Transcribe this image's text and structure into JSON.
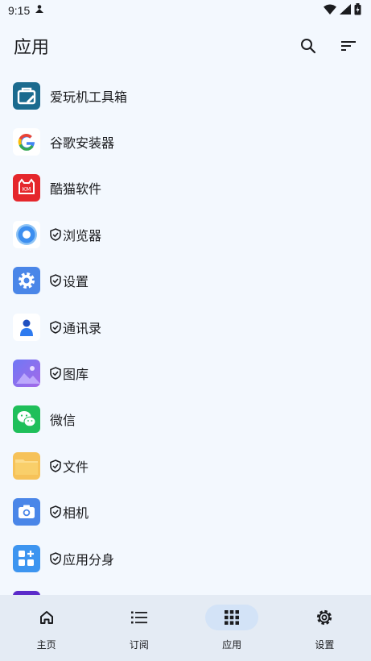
{
  "status": {
    "time": "9:15"
  },
  "header": {
    "title": "应用"
  },
  "apps": [
    {
      "label": "爱玩机工具箱",
      "shield": false,
      "icon": "toolbox-icon",
      "color": "#1b6b8f"
    },
    {
      "label": "谷歌安装器",
      "shield": false,
      "icon": "google-g-icon",
      "color": "#ffffff"
    },
    {
      "label": "酷猫软件",
      "shield": false,
      "icon": "cat-icon",
      "color": "#e5272c"
    },
    {
      "label": "浏览器",
      "shield": true,
      "icon": "browser-icon",
      "color": "#ffffff"
    },
    {
      "label": "设置",
      "shield": true,
      "icon": "settings-icon",
      "color": "#4a86e8"
    },
    {
      "label": "通讯录",
      "shield": true,
      "icon": "contacts-icon",
      "color": "#ffffff"
    },
    {
      "label": "图库",
      "shield": true,
      "icon": "gallery-icon",
      "color": "#7b6cf0"
    },
    {
      "label": "微信",
      "shield": false,
      "icon": "wechat-icon",
      "color": "#1fbf5a"
    },
    {
      "label": "文件",
      "shield": true,
      "icon": "folder-icon",
      "color": "#f6c259"
    },
    {
      "label": "相机",
      "shield": true,
      "icon": "camera-icon",
      "color": "#4a86e8"
    },
    {
      "label": "应用分身",
      "shield": true,
      "icon": "app-clone-icon",
      "color": "#3d95f0"
    }
  ],
  "nav": [
    {
      "label": "主页",
      "icon": "home-icon",
      "active": false
    },
    {
      "label": "订阅",
      "icon": "list-icon",
      "active": false
    },
    {
      "label": "应用",
      "icon": "apps-grid-icon",
      "active": true
    },
    {
      "label": "设置",
      "icon": "gear-icon",
      "active": false
    }
  ]
}
